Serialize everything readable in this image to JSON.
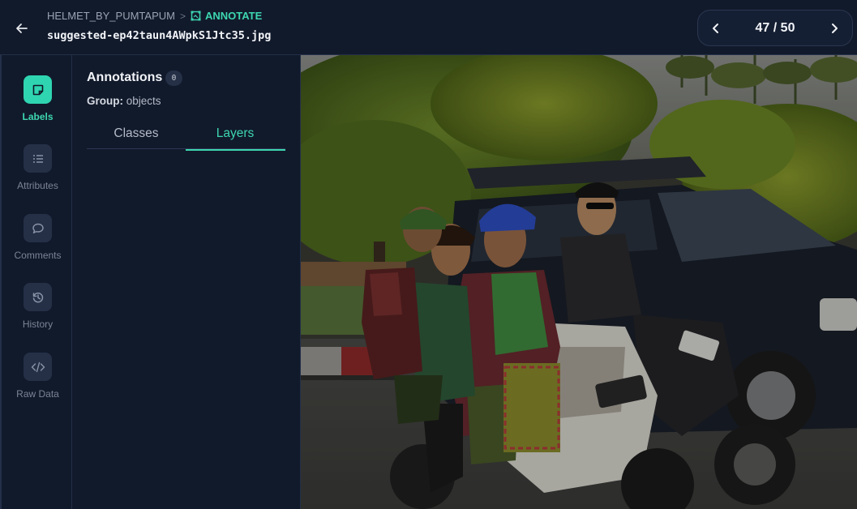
{
  "header": {
    "project": "HELMET_BY_PUMTAPUM",
    "separator": ">",
    "current": "ANNOTATE",
    "filename": "suggested-ep42taun4AWpkS1Jtc35.jpg"
  },
  "pager": {
    "current": 47,
    "total": 50,
    "label": "47 / 50"
  },
  "rail": {
    "items": [
      {
        "label": "Labels",
        "icon": "label-icon",
        "active": true
      },
      {
        "label": "Attributes",
        "icon": "list-icon",
        "active": false
      },
      {
        "label": "Comments",
        "icon": "comment-icon",
        "active": false
      },
      {
        "label": "History",
        "icon": "history-icon",
        "active": false
      },
      {
        "label": "Raw Data",
        "icon": "code-icon",
        "active": false
      }
    ]
  },
  "panel": {
    "title": "Annotations",
    "count": "0",
    "group_label": "Group:",
    "group_value": "objects",
    "tabs": [
      {
        "label": "Classes",
        "active": false
      },
      {
        "label": "Layers",
        "active": true
      }
    ]
  },
  "image": {
    "subject": "photo-three-people-on-motorbike"
  },
  "colors": {
    "accent": "#3dd6b0",
    "background": "#111a2b",
    "border": "#243049"
  }
}
